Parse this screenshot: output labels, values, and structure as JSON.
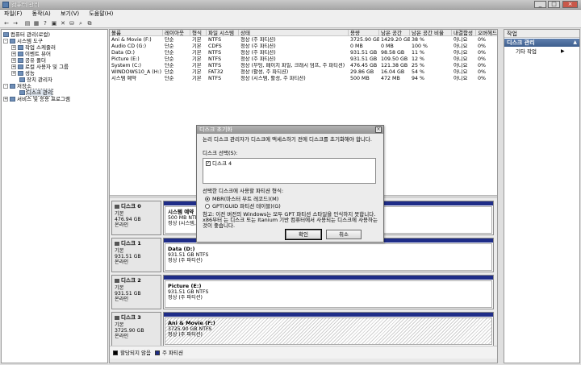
{
  "window": {
    "title": "컴퓨터 관리",
    "min": "_",
    "max": "□",
    "close": "×"
  },
  "menu": [
    "파일(F)",
    "동작(A)",
    "보기(V)",
    "도움말(H)"
  ],
  "toolbar_icons": [
    "←",
    "→",
    "▤",
    "▦",
    "?",
    "▣",
    "✕",
    "⛁",
    "⌕",
    "⧉"
  ],
  "tree": {
    "root": "컴퓨터 관리(로컬)",
    "system_tools": "시스템 도구",
    "task_scheduler": "작업 스케줄러",
    "event_viewer": "이벤트 뷰어",
    "shared_folders": "공유 폴더",
    "local_users": "로컬 사용자 및 그룹",
    "performance": "성능",
    "device_manager": "장치 관리자",
    "storage": "저장소",
    "disk_management": "디스크 관리",
    "services": "서비스 및 응용 프로그램"
  },
  "volume_table": {
    "headers": [
      "볼륨",
      "레이아웃",
      "형식",
      "파일 시스템",
      "상태",
      "용량",
      "남은 공간",
      "남은 공간 비율",
      "내결함성",
      "오버헤드"
    ],
    "rows": [
      [
        "Ani & Movie (F:)",
        "단순",
        "기본",
        "NTFS",
        "정상 (주 파티션)",
        "3725.90 GB",
        "1429.20 GB",
        "38 %",
        "아니요",
        "0%"
      ],
      [
        "Audio CD (G:)",
        "단순",
        "기본",
        "CDFS",
        "정상 (주 파티션)",
        "0 MB",
        "0 MB",
        "100 %",
        "아니요",
        "0%"
      ],
      [
        "Data (D:)",
        "단순",
        "기본",
        "NTFS",
        "정상 (주 파티션)",
        "931.51 GB",
        "98.58 GB",
        "11 %",
        "아니요",
        "0%"
      ],
      [
        "Picture (E:)",
        "단순",
        "기본",
        "NTFS",
        "정상 (주 파티션)",
        "931.51 GB",
        "109.50 GB",
        "12 %",
        "아니요",
        "0%"
      ],
      [
        "System (C:)",
        "단순",
        "기본",
        "NTFS",
        "정상 (부팅, 페이지 파일, 크래시 덤프, 주 파티션)",
        "476.45 GB",
        "121.38 GB",
        "25 %",
        "아니요",
        "0%"
      ],
      [
        "WINDOWS10_A (H:)",
        "단순",
        "기본",
        "FAT32",
        "정상 (활성, 주 파티션)",
        "29.86 GB",
        "16.04 GB",
        "54 %",
        "아니요",
        "0%"
      ],
      [
        "시스템 예약",
        "단순",
        "기본",
        "NTFS",
        "정상 (시스템, 활성, 주 파티션)",
        "500 MB",
        "472 MB",
        "94 %",
        "아니요",
        "0%"
      ]
    ]
  },
  "disks": [
    {
      "name": "디스크 0",
      "type": "기본",
      "size": "476.94 GB",
      "status": "온라인",
      "part_name": "시스템 예약",
      "part_size": "500 MB NTFS",
      "part_status": "정상 (시스템,",
      "hatched": false
    },
    {
      "name": "디스크 1",
      "type": "기본",
      "size": "931.51 GB",
      "status": "온라인",
      "part_name": "Data  (D:)",
      "part_size": "931.51 GB NTFS",
      "part_status": "정상 (주 파티션)",
      "hatched": false
    },
    {
      "name": "디스크 2",
      "type": "기본",
      "size": "931.51 GB",
      "status": "온라인",
      "part_name": "Picture  (E:)",
      "part_size": "931.51 GB NTFS",
      "part_status": "정상 (주 파티션)",
      "hatched": false
    },
    {
      "name": "디스크 3",
      "type": "기본",
      "size": "3725.90 GB",
      "status": "온라인",
      "part_name": "Ani & Movie  (F:)",
      "part_size": "3725.90 GB NTFS",
      "part_status": "정상 (주 파티션)",
      "hatched": true
    }
  ],
  "legend": {
    "unallocated": "할당되지 않음",
    "primary": "주 파티션",
    "unallocated_color": "#000000",
    "primary_color": "#1f2d88"
  },
  "actions": {
    "header": "작업",
    "group": "디스크 관리",
    "item": "기타 작업",
    "arrow_up": "▲",
    "arrow_right": "▶"
  },
  "dialog": {
    "title": "디스크 초기화",
    "close": "×",
    "intro": "논리 디스크 관리자가 디스크에 액세스하기 전에 디스크를 초기화해야 합니다.",
    "select_label": "디스크 선택(S):",
    "disk_item": "디스크 4",
    "disk_checked": true,
    "style_label": "선택한 디스크에 사용할 파티션 형식:",
    "mbr": "MBR(마스터 부트 레코드)(M)",
    "gpt": "GPT(GUID 파티션 테이블)(G)",
    "selected_style": "mbr",
    "note1": "참고: 이전 버전의 Windows는 모두 GPT 파티션 스타일을 인식하지 못합니다.",
    "note2": "x86부터 는 디스크 또는 Itanium 기반 컴퓨터에서 사용되는 디스크에 사용하는",
    "note3": "것이 좋습니다.",
    "ok": "확인",
    "cancel": "취소"
  }
}
